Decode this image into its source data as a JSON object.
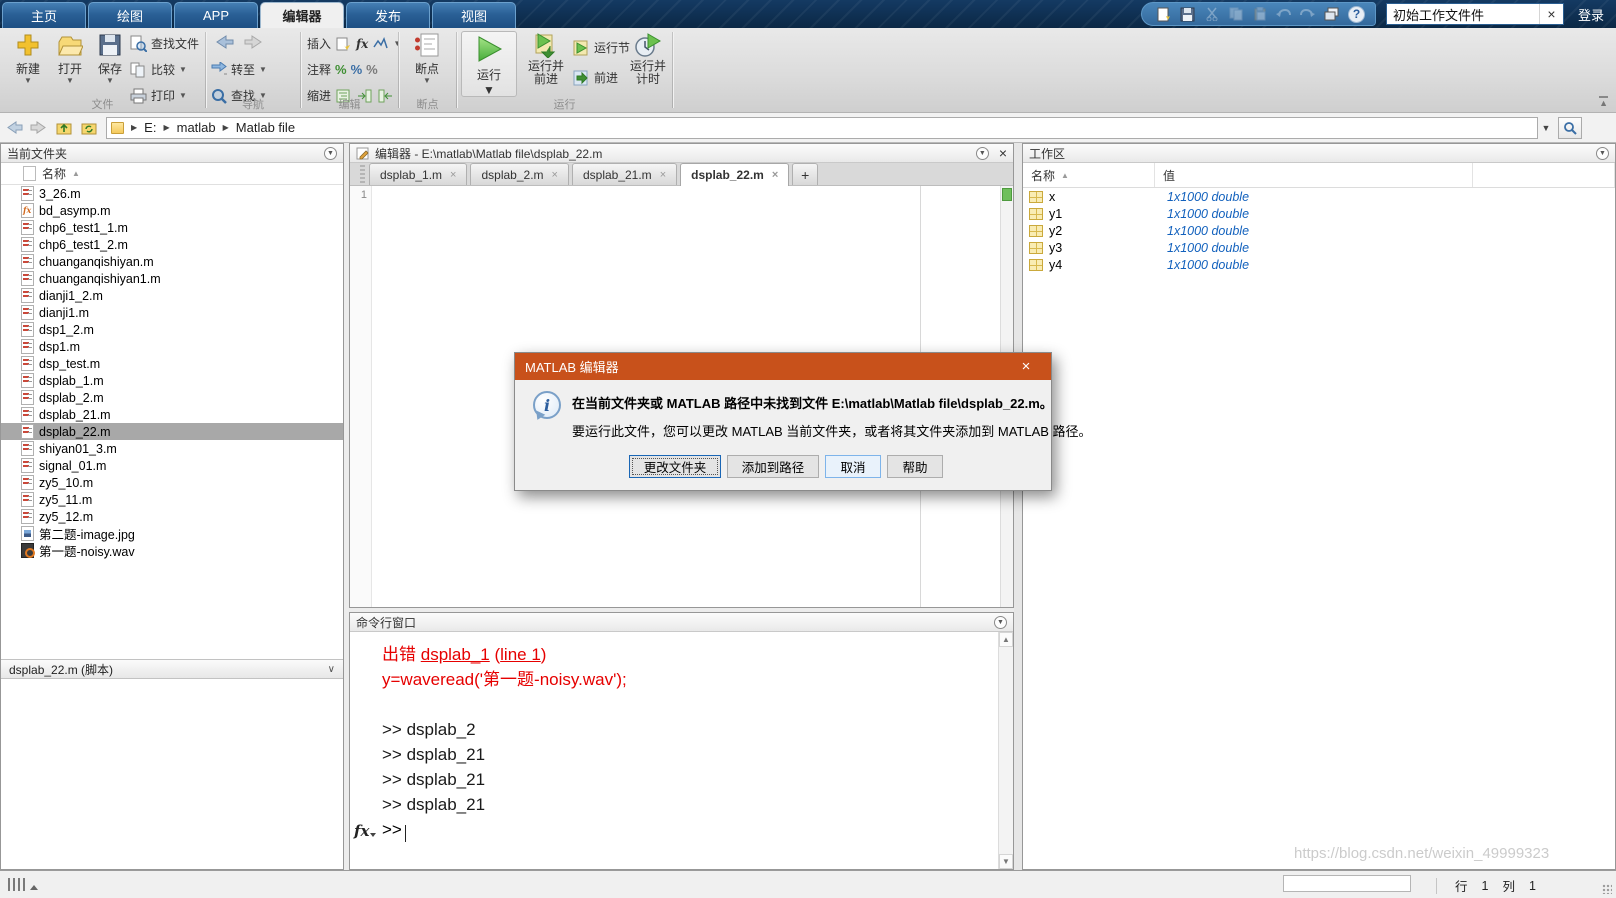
{
  "icons": {
    "dropdown": "▼",
    "sort_asc": "▲",
    "chevron_down": "∨",
    "close": "×",
    "crumb_sep": "▶",
    "plus": "+",
    "fx": "fx",
    "menu_arrow": "▼",
    "collapse": "▲",
    "scroll_up": "▲",
    "scroll_down": "▼",
    "help": "?",
    "percent": "%",
    "insert_fx": "fx"
  },
  "titlebar": {
    "tabs": [
      "主页",
      "绘图",
      "APP",
      "编辑器",
      "发布",
      "视图"
    ],
    "search_value": "初始工作文件件",
    "login_label": "登录"
  },
  "ribbon": {
    "file_group": {
      "label": "文件",
      "new": "新建",
      "open": "打开",
      "save": "保存",
      "find_files": "查找文件",
      "compare": "比较",
      "print": "打印"
    },
    "nav_group": {
      "label": "导航",
      "goto": "转至",
      "find": "查找"
    },
    "edit_group": {
      "label": "编辑",
      "insert": "插入",
      "comment": "注释",
      "indent": "缩进"
    },
    "bp_group": {
      "label": "断点",
      "breakpoints": "断点"
    },
    "run_group": {
      "label": "运行",
      "run": "运行",
      "run_advance_1": "运行并",
      "run_advance_2": "前进",
      "run_section": "运行节",
      "advance": "前进",
      "run_time_1": "运行并",
      "run_time_2": "计时"
    }
  },
  "addressbar": {
    "crumbs": [
      "E:",
      "matlab",
      "Matlab file"
    ]
  },
  "left_panel": {
    "title": "当前文件夹",
    "name_column": "名称",
    "files": [
      {
        "name": "3_26.m",
        "icon": "m-file"
      },
      {
        "name": "bd_asymp.m",
        "icon": "function-file"
      },
      {
        "name": "chp6_test1_1.m",
        "icon": "m-file"
      },
      {
        "name": "chp6_test1_2.m",
        "icon": "m-file"
      },
      {
        "name": "chuanganqishiyan.m",
        "icon": "m-file"
      },
      {
        "name": "chuanganqishiyan1.m",
        "icon": "m-file"
      },
      {
        "name": "dianji1_2.m",
        "icon": "m-file"
      },
      {
        "name": "dianji1.m",
        "icon": "m-file"
      },
      {
        "name": "dsp1_2.m",
        "icon": "m-file"
      },
      {
        "name": "dsp1.m",
        "icon": "m-file"
      },
      {
        "name": "dsp_test.m",
        "icon": "m-file"
      },
      {
        "name": "dsplab_1.m",
        "icon": "m-file"
      },
      {
        "name": "dsplab_2.m",
        "icon": "m-file"
      },
      {
        "name": "dsplab_21.m",
        "icon": "m-file"
      },
      {
        "name": "dsplab_22.m",
        "icon": "m-file",
        "selected": true
      },
      {
        "name": "shiyan01_3.m",
        "icon": "m-file"
      },
      {
        "name": "signal_01.m",
        "icon": "m-file"
      },
      {
        "name": "zy5_10.m",
        "icon": "m-file"
      },
      {
        "name": "zy5_11.m",
        "icon": "m-file"
      },
      {
        "name": "zy5_12.m",
        "icon": "m-file"
      },
      {
        "name": "第二题-image.jpg",
        "icon": "image-file"
      },
      {
        "name": "第一题-noisy.wav",
        "icon": "audio-file"
      }
    ],
    "detail_bar": "dsplab_22.m  (脚本)"
  },
  "editor": {
    "title": "编辑器 - E:\\matlab\\Matlab file\\dsplab_22.m",
    "tabs": [
      {
        "label": "dsplab_1.m"
      },
      {
        "label": "dsplab_2.m"
      },
      {
        "label": "dsplab_21.m"
      },
      {
        "label": "dsplab_22.m",
        "active": true
      }
    ],
    "line_number": "1"
  },
  "command_window": {
    "title": "命令行窗口",
    "error_prefix": "出错 ",
    "error_link1": "dsplab_1",
    "error_mid": " (",
    "error_link2": "line 1",
    "error_suffix": ")",
    "error_line2": "y=waveread('第一题-noisy.wav');",
    "history": [
      ">> dsplab_2",
      ">> dsplab_21",
      ">> dsplab_21",
      ">> dsplab_21"
    ],
    "prompt": ">>"
  },
  "workspace": {
    "title": "工作区",
    "columns": {
      "name": "名称",
      "value": "值"
    },
    "vars": [
      {
        "name": "x",
        "value": "1x1000 double"
      },
      {
        "name": "y1",
        "value": "1x1000 double"
      },
      {
        "name": "y2",
        "value": "1x1000 double"
      },
      {
        "name": "y3",
        "value": "1x1000 double"
      },
      {
        "name": "y4",
        "value": "1x1000 double"
      }
    ]
  },
  "dialog": {
    "title": "MATLAB 编辑器",
    "message1": "在当前文件夹或 MATLAB 路径中未找到文件 E:\\matlab\\Matlab file\\dsplab_22.m。",
    "message2": "要运行此文件，您可以更改 MATLAB 当前文件夹，或者将其文件夹添加到 MATLAB 路径。",
    "buttons": {
      "change_folder": "更改文件夹",
      "add_to_path": "添加到路径",
      "cancel": "取消",
      "help": "帮助"
    }
  },
  "statusbar": {
    "row_label": "行",
    "row_value": "1",
    "col_label": "列",
    "col_value": "1"
  },
  "watermark": "https://blog.csdn.net/weixin_49999323"
}
